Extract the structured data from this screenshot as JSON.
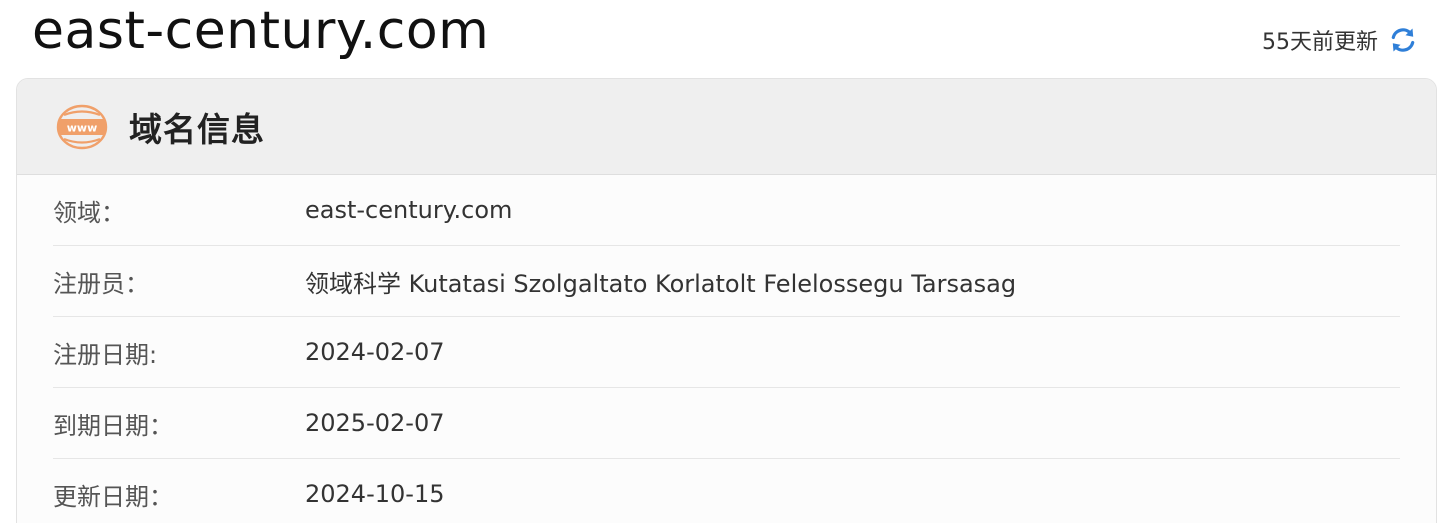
{
  "page": {
    "domain": "east-century.com",
    "updated_text": "55天前更新",
    "refresh_icon": "refresh-icon"
  },
  "card": {
    "icon": "www-globe-icon",
    "title": "域名信息",
    "rows": [
      {
        "label": "领域：",
        "value": "east-century.com"
      },
      {
        "label": "注册员：",
        "value": "领域科学 Kutatasi Szolgaltato Korlatolt Felelossegu Tarsasag"
      },
      {
        "label": "注册日期:",
        "value": "2024-02-07"
      },
      {
        "label": "到期日期：",
        "value": "2025-02-07"
      },
      {
        "label": "更新日期：",
        "value": "2024-10-15"
      }
    ]
  },
  "colors": {
    "icon_orange": "#f0a06a",
    "refresh_blue": "#2f7fd8",
    "header_bg": "#efefef"
  }
}
